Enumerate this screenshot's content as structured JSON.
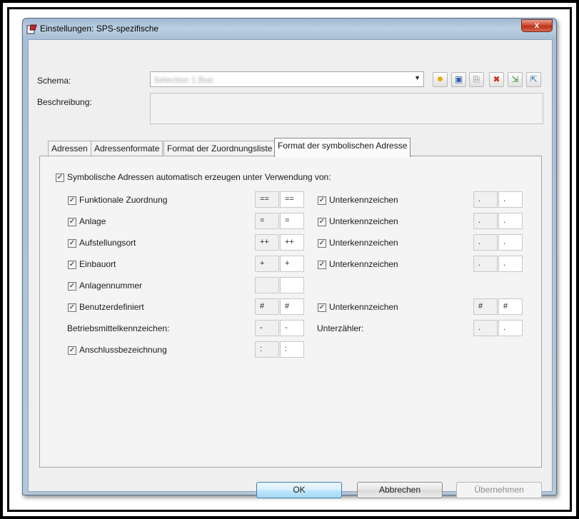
{
  "window": {
    "title": "Einstellungen: SPS-spezifische",
    "close": "x"
  },
  "schema": {
    "label": "Schema:",
    "value": "Selection 1.Bus"
  },
  "description": {
    "label": "Beschreibung:",
    "value": ""
  },
  "toolbar": {
    "icons": [
      "new-icon",
      "save-icon",
      "copy-icon",
      "delete-icon",
      "import-icon",
      "export-icon"
    ],
    "glyphs": [
      "✸",
      "▣",
      "⎘",
      "✖",
      "⇲",
      "⇱"
    ],
    "colors": [
      "#e6a800",
      "#2f5fa8",
      "#7a7a7a",
      "#d42a1c",
      "#2f8a3a",
      "#2a6fb5"
    ]
  },
  "tabs": [
    "Adressen",
    "Adressenformate",
    "Format der Zuordnungsliste",
    "Format der symbolischen Adresse"
  ],
  "auto": {
    "checked": true,
    "label": "Symbolische Adressen automatisch erzeugen unter Verwendung von:"
  },
  "rows": [
    {
      "label": "Funktionale Zuordnung",
      "checked": true,
      "f1": "==",
      "f2": "==",
      "sub_label": "Unterkennzeichen",
      "sub_checked": true,
      "s1": ".",
      "s2": "."
    },
    {
      "label": "Anlage",
      "checked": true,
      "f1": "=",
      "f2": "=",
      "sub_label": "Unterkennzeichen",
      "sub_checked": true,
      "s1": ".",
      "s2": "."
    },
    {
      "label": "Aufstellungsort",
      "checked": true,
      "f1": "++",
      "f2": "++",
      "sub_label": "Unterkennzeichen",
      "sub_checked": true,
      "s1": ".",
      "s2": "."
    },
    {
      "label": "Einbauort",
      "checked": true,
      "f1": "+",
      "f2": "+",
      "sub_label": "Unterkennzeichen",
      "sub_checked": true,
      "s1": ".",
      "s2": "."
    },
    {
      "label": "Anlagennummer",
      "checked": true,
      "f1": "",
      "f2": ""
    },
    {
      "label": "Benutzerdefiniert",
      "checked": true,
      "f1": "#",
      "f2": "#",
      "sub_label": "Unterkennzeichen",
      "sub_checked": true,
      "s1": "#",
      "s2": "#"
    },
    {
      "label": "Betriebsmittelkennzeichen:",
      "f1": "-",
      "f2": "-",
      "sub_label": "Unterzähler:",
      "s1": ".",
      "s2": "."
    },
    {
      "label": "Anschlussbezeichnung",
      "checked": true,
      "f1": ":",
      "f2": ":"
    }
  ],
  "buttons": {
    "ok": "OK",
    "cancel": "Abbrechen",
    "apply": "Übernehmen"
  }
}
